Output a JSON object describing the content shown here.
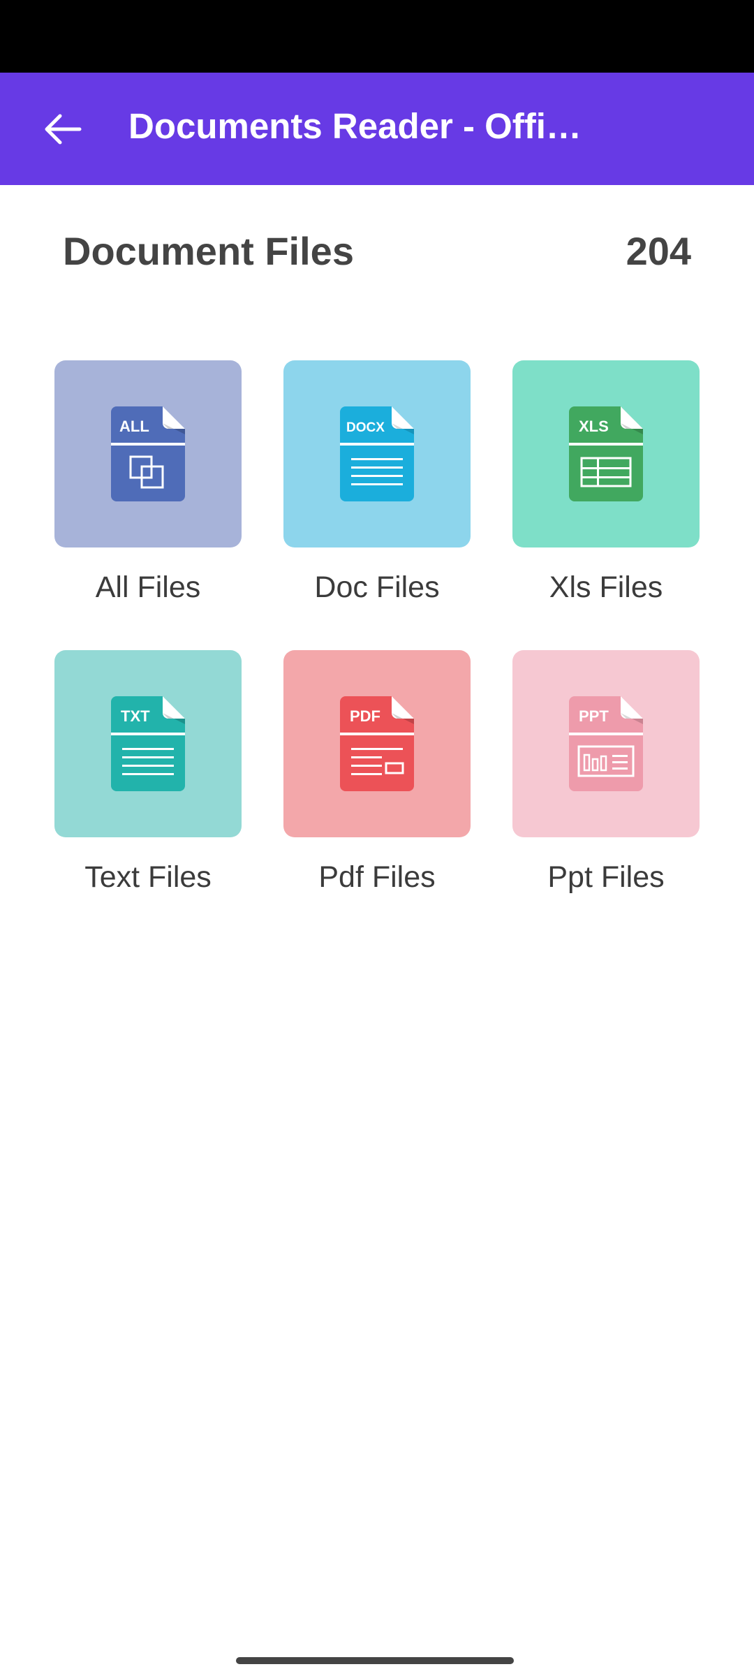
{
  "app_bar": {
    "title": "Documents Reader - Offi…",
    "back_icon": "arrow-back-icon"
  },
  "section": {
    "title": "Document Files",
    "count": "204"
  },
  "categories": [
    {
      "label": "All Files",
      "badge": "ALL",
      "icon": "all-files-icon",
      "bg": "#A7B3D9",
      "doc": "#4F6CB8"
    },
    {
      "label": "Doc Files",
      "badge": "DOCX",
      "icon": "doc-file-icon",
      "bg": "#8DD5EC",
      "doc": "#1BAEDC"
    },
    {
      "label": "Xls Files",
      "badge": "XLS",
      "icon": "xls-file-icon",
      "bg": "#7EDFC8",
      "doc": "#41A85F"
    },
    {
      "label": "Text Files",
      "badge": "TXT",
      "icon": "txt-file-icon",
      "bg": "#93D9D5",
      "doc": "#22B3AB"
    },
    {
      "label": "Pdf Files",
      "badge": "PDF",
      "icon": "pdf-file-icon",
      "bg": "#F3A7AA",
      "doc": "#EC5257"
    },
    {
      "label": "Ppt Files",
      "badge": "PPT",
      "icon": "ppt-file-icon",
      "bg": "#F6C8D2",
      "doc": "#EE9BAB"
    }
  ]
}
